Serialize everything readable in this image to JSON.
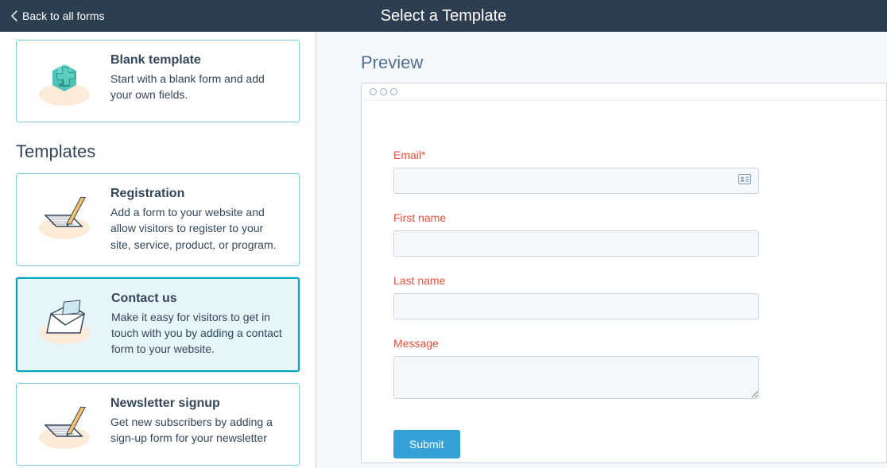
{
  "topbar": {
    "back_label": "Back to all forms",
    "title": "Select a Template"
  },
  "sidebar": {
    "blank_card": {
      "title": "Blank template",
      "desc": "Start with a blank form and add your own fields."
    },
    "templates_heading": "Templates",
    "templates": [
      {
        "title": "Registration",
        "desc": "Add a form to your website and allow visitors to register to your site, service, product, or program."
      },
      {
        "title": "Contact us",
        "desc": "Make it easy for visitors to get in touch with you by adding a contact form to your website."
      },
      {
        "title": "Newsletter signup",
        "desc": "Get new subscribers by adding a sign-up form for your newsletter"
      }
    ]
  },
  "preview": {
    "heading": "Preview",
    "fields": [
      {
        "label": "Email*",
        "type": "text",
        "has_contact_icon": true
      },
      {
        "label": "First name",
        "type": "text"
      },
      {
        "label": "Last name",
        "type": "text"
      },
      {
        "label": "Message",
        "type": "textarea"
      }
    ],
    "submit_label": "Submit"
  }
}
